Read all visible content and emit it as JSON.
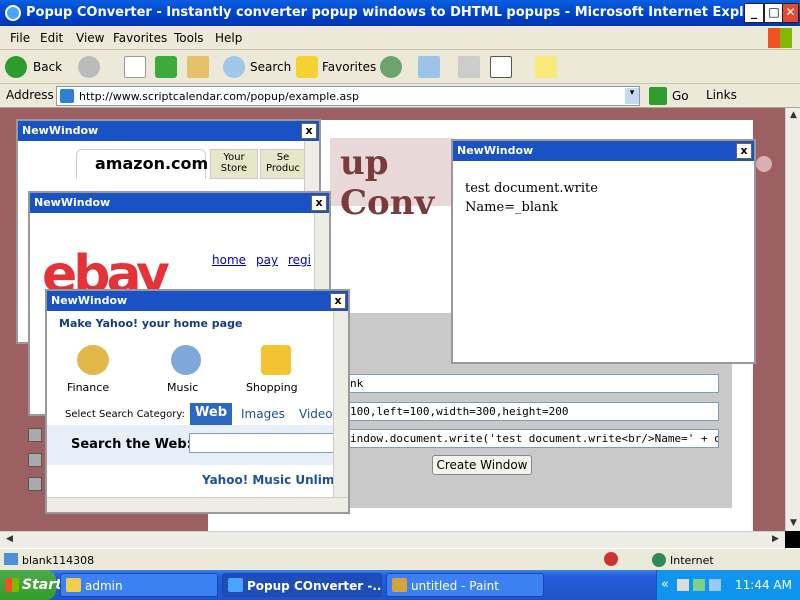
{
  "window": {
    "title": "Popup COnverter - Instantly converter popup windows to DHTML popups - Microsoft Internet Explorer",
    "minimize": "_",
    "maximize": "□",
    "close": "✕"
  },
  "menu": [
    "File",
    "Edit",
    "View",
    "Favorites",
    "Tools",
    "Help"
  ],
  "toolbar": {
    "back": "Back",
    "search": "Search",
    "favorites": "Favorites"
  },
  "address": {
    "label": "Address",
    "url": "http://www.scriptcalendar.com/popup/example.asp",
    "go": "Go",
    "links": "Links"
  },
  "page": {
    "banner_text": "up Conv",
    "field_name": "nk",
    "field_features": "100,left=100,width=300,height=200",
    "field_script": "indow.document.write('test document.write<br/>Name=' + objW",
    "create_button": "Create Window"
  },
  "popups": {
    "amazon": {
      "title": "NewWindow",
      "close": "x",
      "logo": "amazon.com",
      "tab1": "Your Store",
      "tab2": "Se Produc"
    },
    "ebay": {
      "title": "NewWindow",
      "close": "x",
      "logo": "ebay",
      "links": [
        "home",
        "pay",
        "regi"
      ]
    },
    "yahoo": {
      "title": "NewWindow",
      "close": "x",
      "homepage": "Make Yahoo! your home page",
      "categories": [
        {
          "label": "Finance",
          "icon": "coins-icon"
        },
        {
          "label": "Music",
          "icon": "music-icon"
        },
        {
          "label": "Shopping",
          "icon": "shopping-bag-icon"
        }
      ],
      "search_category_label": "Select Search Category:",
      "search_tabs": [
        "Web",
        "Images",
        "Video"
      ],
      "search_label": "Search the Web:",
      "promo": "Yahoo! Music Unlim"
    },
    "test": {
      "title": "NewWindow",
      "close": "x",
      "line1": "test document.write",
      "line2": "Name=_blank"
    }
  },
  "status": {
    "text": "blank114308",
    "zone": "Internet"
  },
  "taskbar": {
    "start": "Start",
    "tasks": [
      {
        "label": "admin"
      },
      {
        "label": "Popup COnverter -..."
      },
      {
        "label": "untitled - Paint"
      }
    ],
    "tray_chevron": "«",
    "clock": "11:44 AM"
  },
  "colors": {
    "titlebar": "#0040c8",
    "page_bg": "#9c5f62",
    "popup_title": "#1852c4",
    "taskbar": "#245edb",
    "start": "#329e2c"
  }
}
